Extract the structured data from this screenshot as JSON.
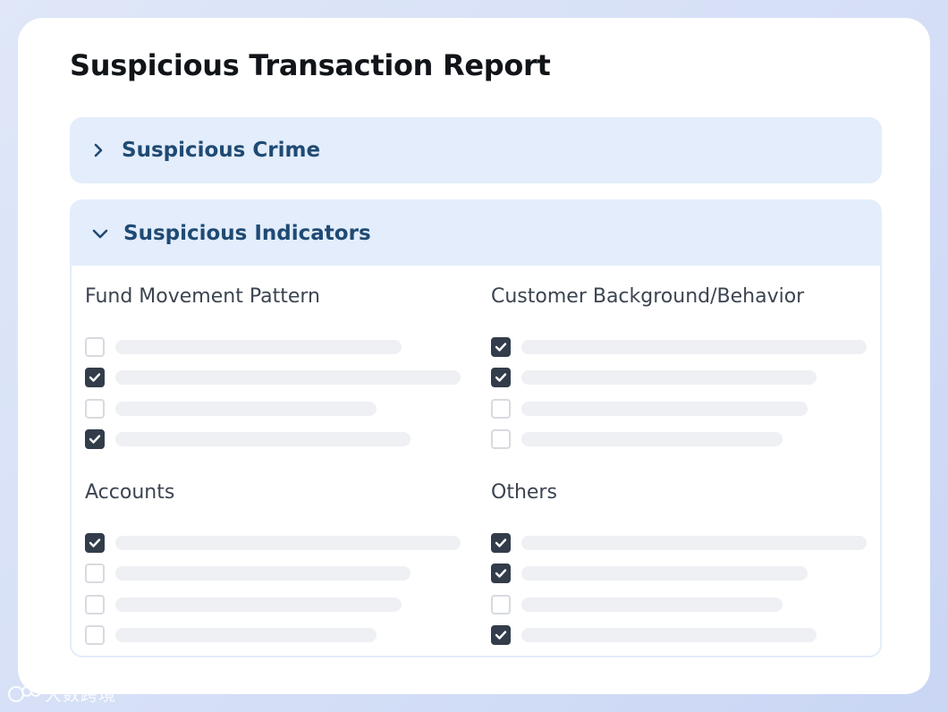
{
  "report": {
    "title": "Suspicious Transaction Report"
  },
  "accordions": [
    {
      "label": "Suspicious Crime",
      "expanded": false,
      "icon": "chevron-right-icon"
    },
    {
      "label": "Suspicious Indicators",
      "expanded": true,
      "icon": "chevron-down-icon"
    }
  ],
  "groups": [
    {
      "title": "Fund Movement Pattern",
      "items": [
        {
          "checked": false
        },
        {
          "checked": true
        },
        {
          "checked": false
        },
        {
          "checked": true
        }
      ]
    },
    {
      "title": "Customer Background/Behavior",
      "items": [
        {
          "checked": true
        },
        {
          "checked": true
        },
        {
          "checked": false
        },
        {
          "checked": false
        }
      ]
    },
    {
      "title": "Accounts",
      "items": [
        {
          "checked": true
        },
        {
          "checked": false
        },
        {
          "checked": false
        },
        {
          "checked": false
        }
      ]
    },
    {
      "title": "Others",
      "items": [
        {
          "checked": true
        },
        {
          "checked": true
        },
        {
          "checked": false
        },
        {
          "checked": true
        }
      ]
    }
  ],
  "watermark": "大数跨境",
  "colors": {
    "accent_text": "#1f4a73",
    "accordion_bg": "#e3edfb",
    "checkbox_checked": "#333c4a"
  }
}
